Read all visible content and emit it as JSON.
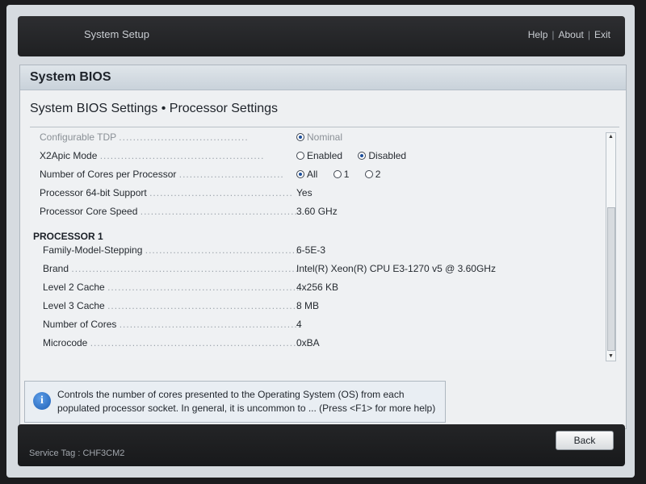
{
  "topbar": {
    "title": "System Setup",
    "help": "Help",
    "about": "About",
    "exit": "Exit",
    "separator": "|"
  },
  "section": {
    "title": "System BIOS",
    "subtitle": "System BIOS Settings • Processor Settings"
  },
  "settings": {
    "configurable_tdp": {
      "label": "Configurable TDP",
      "option": "Nominal"
    },
    "x2apic": {
      "label": "X2Apic Mode",
      "options": [
        "Enabled",
        "Disabled"
      ],
      "selected": "Disabled"
    },
    "cores_per_processor": {
      "label": "Number of Cores per Processor",
      "options": [
        "All",
        "1",
        "2"
      ],
      "selected": "All"
    },
    "support64": {
      "label": "Processor 64-bit Support",
      "value": "Yes"
    },
    "core_speed": {
      "label": "Processor Core Speed",
      "value": "3.60 GHz"
    }
  },
  "processor1": {
    "heading": "PROCESSOR 1",
    "rows": [
      {
        "label": "Family-Model-Stepping",
        "value": "6-5E-3"
      },
      {
        "label": "Brand",
        "value": "Intel(R) Xeon(R) CPU E3-1270 v5 @ 3.60GHz"
      },
      {
        "label": "Level 2 Cache",
        "value": "4x256 KB"
      },
      {
        "label": "Level 3 Cache",
        "value": "8 MB"
      },
      {
        "label": "Number of Cores",
        "value": "4"
      },
      {
        "label": "Microcode",
        "value": "0xBA"
      }
    ]
  },
  "help": {
    "line1": "Controls the number of cores presented to the Operating System (OS) from each",
    "line2": "populated processor socket. In general, it is uncommon to ... (Press <F1> for more help)"
  },
  "footer": {
    "service_tag": "Service Tag : CHF3CM2",
    "back_label": "Back"
  }
}
